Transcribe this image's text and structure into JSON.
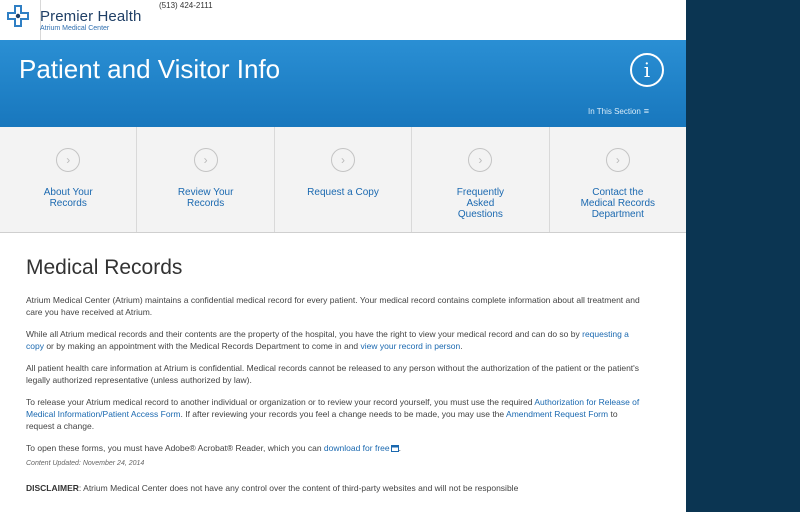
{
  "header": {
    "brand": "Premier Health",
    "brand_sub": "Atrium Medical Center",
    "phone": "(513) 424-2111"
  },
  "banner": {
    "title": "Patient and Visitor Info",
    "info_icon": "i",
    "section_link": "In This Section",
    "menu_icon": "≡"
  },
  "tiles": [
    {
      "label": "About Your\nRecords",
      "icon": "chevron-right-circle"
    },
    {
      "label": "Review Your\nRecords",
      "icon": "chevron-right-circle"
    },
    {
      "label": "Request a Copy",
      "icon": "chevron-right-circle"
    },
    {
      "label": "Frequently\nAsked\nQuestions",
      "icon": "chevron-right-circle"
    },
    {
      "label": "Contact the\nMedical Records\nDepartment",
      "icon": "chevron-right-circle"
    }
  ],
  "content": {
    "title": "Medical Records",
    "p1": "Atrium Medical Center (Atrium) maintains a confidential medical record for every patient. Your medical record contains complete information about all treatment and care you have received at Atrium.",
    "p2_a": "While all Atrium medical records and their contents are the property of the hospital, you have the right to view your medical record and can do so by ",
    "p2_link1": "requesting a copy",
    "p2_b": " or by making an appointment with the Medical Records Department to come in and ",
    "p2_link2": "view your record in person",
    "p2_c": ".",
    "p3": "All patient health care information at Atrium is confidential. Medical records cannot be released to any person without the authorization of the patient or the patient's legally authorized representative (unless authorized by law).",
    "p4_a": "To release your Atrium medical record to another individual or organization or to review your record yourself, you must use the required ",
    "p4_link1": "Authorization for Release of Medical Information/Patient Access Form",
    "p4_b": ". If after reviewing your records you feel a change needs to be made, you may use the ",
    "p4_link2": "Amendment Request Form",
    "p4_c": " to request a change.",
    "p5_a": "To open these forms, you must have Adobe® Acrobat® Reader, which you can ",
    "p5_link": "download for free",
    "p5_b": ".",
    "updated": "Content Updated: November 24, 2014",
    "disclaimer_label": "DISCLAIMER",
    "disclaimer_text": ": Atrium Medical Center does not have any control over the content of third-party websites and will not be responsible"
  },
  "colors": {
    "banner": "#1f82c8",
    "link": "#1b69b0",
    "rail": "#0b3552"
  }
}
